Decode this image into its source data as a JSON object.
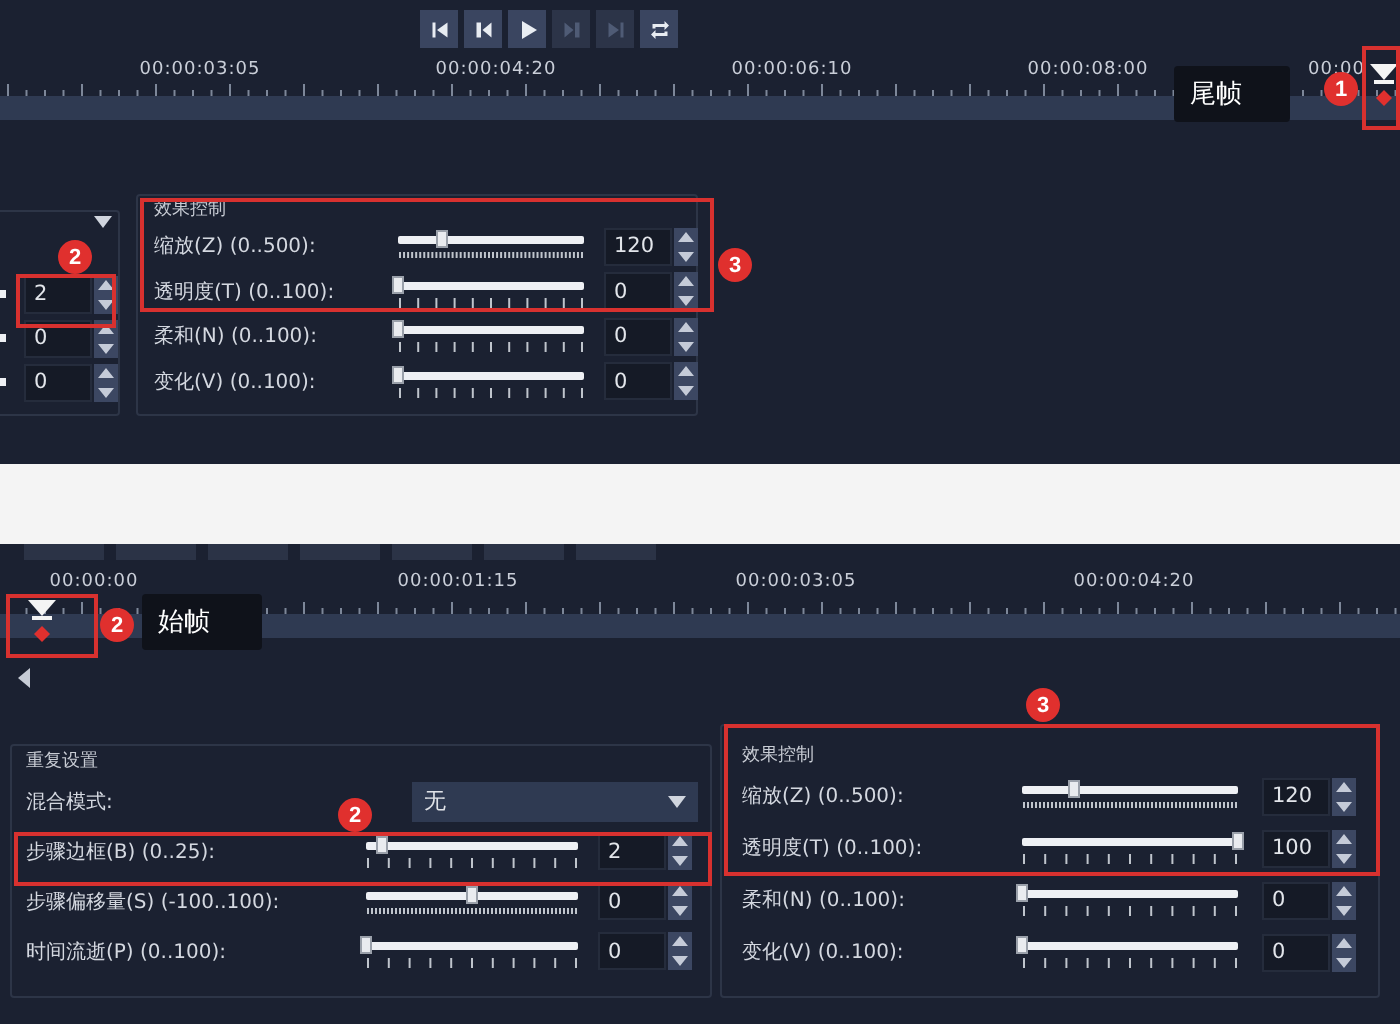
{
  "top_panel": {
    "transport_buttons": [
      {
        "kind": "first",
        "disabled": false
      },
      {
        "kind": "prev",
        "disabled": false
      },
      {
        "kind": "play",
        "disabled": false
      },
      {
        "kind": "next",
        "disabled": true
      },
      {
        "kind": "last",
        "disabled": true
      },
      {
        "kind": "repeat",
        "disabled": false
      }
    ],
    "timeline": {
      "ruler_labels": [
        "00:00:03:05",
        "00:00:04:20",
        "00:00:06:10",
        "00:00:08:00",
        "00:00"
      ],
      "tooltip": "尾帧",
      "badge": "1"
    },
    "partial_group": {
      "badge": "2",
      "values": [
        "2",
        "0",
        "0"
      ]
    },
    "effects": {
      "title": "效果控制",
      "badge": "3",
      "rows": [
        {
          "label": "缩放(Z) (0..500):",
          "level": 0.24,
          "value": "120",
          "fine_ticks": true
        },
        {
          "label": "透明度(T) (0..100):",
          "level": 0,
          "value": "0",
          "fine_ticks": false
        },
        {
          "label": "柔和(N) (0..100):",
          "level": 0,
          "value": "0",
          "fine_ticks": false
        },
        {
          "label": "变化(V) (0..100):",
          "level": 0,
          "value": "0",
          "fine_ticks": false
        }
      ]
    }
  },
  "bottom_panel": {
    "timeline": {
      "ruler_labels": [
        "00:00:00",
        "00:00:01:15",
        "00:00:03:05",
        "00:00:04:20"
      ],
      "tooltip": "始帧",
      "badge": "2"
    },
    "repeat_settings": {
      "title": "重复设置",
      "blend_label": "混合模式:",
      "blend_value": "无",
      "badge": "2",
      "rows": [
        {
          "label": "步骤边框(B) (0..25):",
          "level": 0.08,
          "value": "2",
          "fine_ticks": false
        },
        {
          "label": "步骤偏移量(S) (-100..100):",
          "level": 0.5,
          "value": "0",
          "fine_ticks": true
        },
        {
          "label": "时间流逝(P) (0..100):",
          "level": 0,
          "value": "0",
          "fine_ticks": false
        }
      ]
    },
    "effects": {
      "title": "效果控制",
      "badge": "3",
      "rows": [
        {
          "label": "缩放(Z) (0..500):",
          "level": 0.24,
          "value": "120",
          "fine_ticks": true
        },
        {
          "label": "透明度(T) (0..100):",
          "level": 1,
          "value": "100",
          "fine_ticks": false
        },
        {
          "label": "柔和(N) (0..100):",
          "level": 0,
          "value": "0",
          "fine_ticks": false
        },
        {
          "label": "变化(V) (0..100):",
          "level": 0,
          "value": "0",
          "fine_ticks": false
        }
      ]
    }
  }
}
